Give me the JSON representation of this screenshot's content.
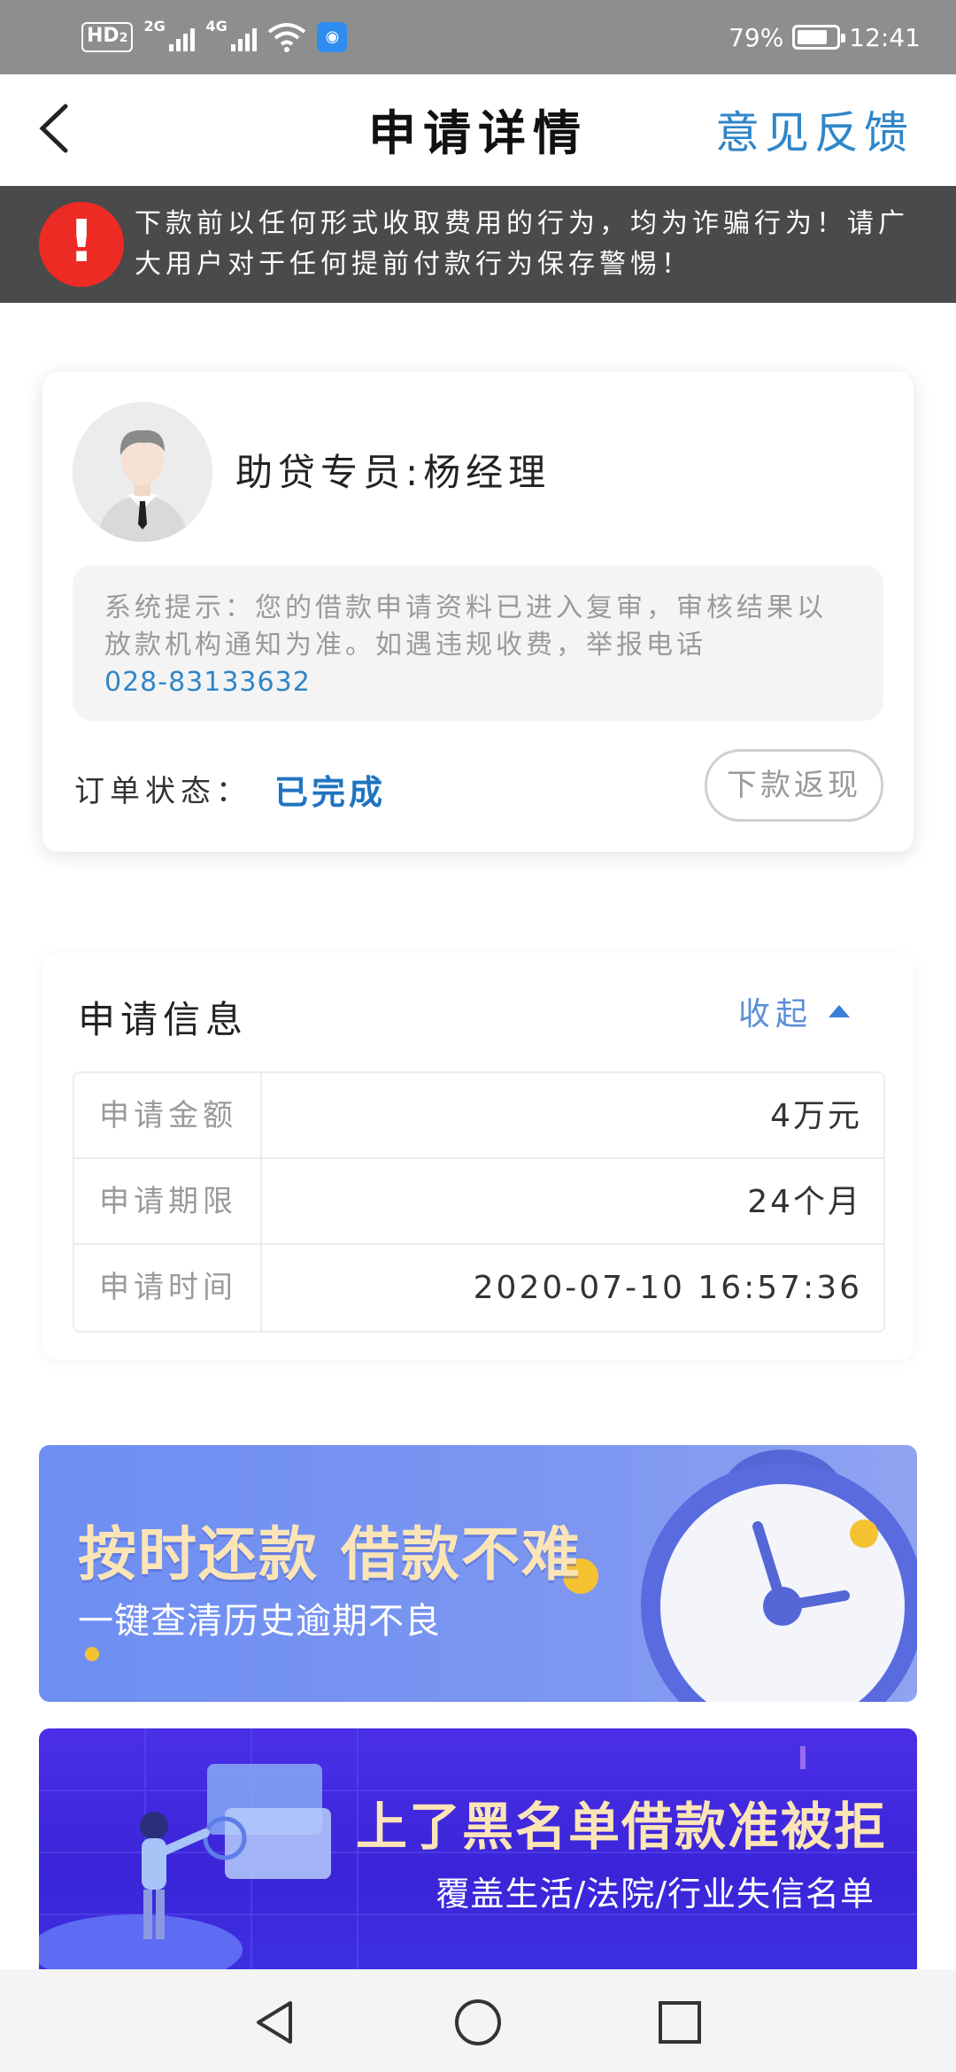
{
  "status_bar": {
    "hd_label": "HD",
    "hd_sub": "2",
    "net1": "2G",
    "net2": "4G",
    "battery_pct": "79%",
    "battery_level": 0.79,
    "time": "12:41"
  },
  "header": {
    "back_icon": "chevron-left-icon",
    "title": "申请详情",
    "feedback_label": "意见反馈"
  },
  "warning": {
    "icon": "exclamation-icon",
    "text": "下款前以任何形式收取费用的行为，均为诈骗行为！请广大用户对于任何提前付款行为保存警惕！"
  },
  "agent": {
    "name": "助贷专员:杨经理",
    "tip_text": "系统提示：您的借款申请资料已进入复审，审核结果以放款机构通知为准。如遇违规收费，举报电话",
    "tip_phone": "028-83133632",
    "status_label": "订单状态：",
    "status_value": "已完成",
    "cashback_label": "下款返现"
  },
  "info": {
    "title": "申请信息",
    "collapse_label": "收起",
    "rows": [
      {
        "key": "申请金额",
        "value": "4万元"
      },
      {
        "key": "申请期限",
        "value": "24个月"
      },
      {
        "key": "申请时间",
        "value": "2020-07-10 16:57:36"
      }
    ]
  },
  "banner1": {
    "title": "按时还款 借款不难",
    "subtitle": "一键查清历史逾期不良"
  },
  "banner2": {
    "title": "上了黑名单借款准被拒",
    "subtitle": "覆盖生活/法院/行业失信名单"
  },
  "colors": {
    "accent": "#2f86c9",
    "status_done": "#1f74c0",
    "warning_bg": "#4a4a4a",
    "warning_icon": "#ee2a24"
  }
}
